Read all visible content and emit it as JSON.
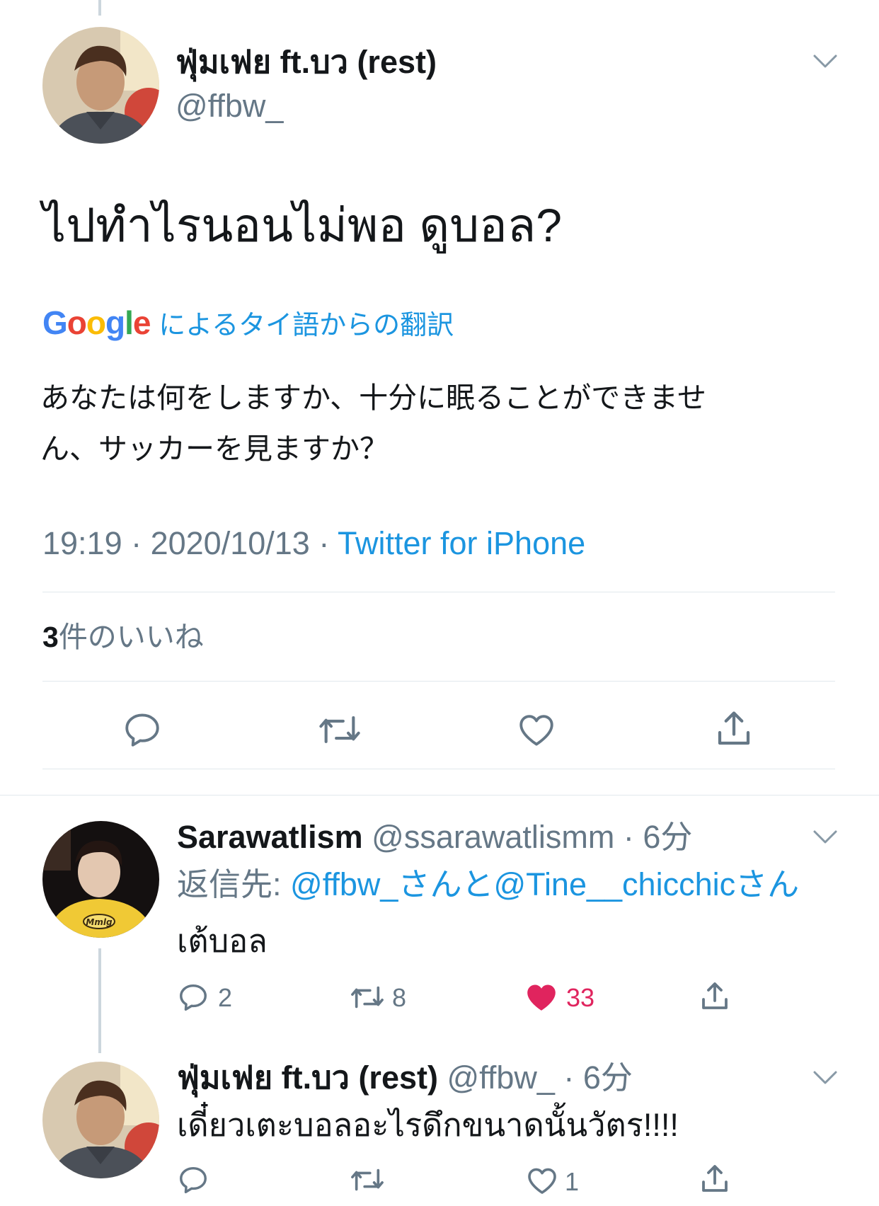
{
  "main_tweet": {
    "display_name": "ฟุ่มเฟย ft.บว (rest)",
    "handle": "@ffbw_",
    "text": "ไปทำไรนอนไม่พอ ดูบอล?",
    "translation_brand": "Google",
    "translation_label": "によるタイ語からの翻訳",
    "translation_line1": "あなたは何をしますか、十分に眠ることができませ",
    "translation_line2": "ん、サッカーを見ますか？",
    "time": "19:19 · 2020/10/13 · ",
    "source": "Twitter for iPhone",
    "likes_count": "3",
    "likes_label": "件のいいね"
  },
  "reply1": {
    "display_name": "Sarawatlism",
    "handle_time": "@ssarawatlismm · 6分",
    "reply_prefix": "返信先: ",
    "reply_targets": "@ffbw_さんと@Tine__chicchicさん",
    "text": "เต้บอล",
    "reply_count": "2",
    "retweet_count": "8",
    "like_count": "33"
  },
  "reply2": {
    "display_name": "ฟุ่มเฟย ft.บว (rest)",
    "handle_time": "@ffbw_ · 6分",
    "text": "เดี๋ยวเตะบอลอะไรดึกขนาดนั้นวัตร!!!!",
    "reply_count": "",
    "retweet_count": "",
    "like_count": "1"
  },
  "colors": {
    "accent": "#1b95e0",
    "like": "#e0245e",
    "muted": "#657786",
    "divider": "#e1e8ed"
  },
  "icons": [
    "reply-icon",
    "retweet-icon",
    "like-icon",
    "share-icon",
    "chevron-down-icon"
  ]
}
